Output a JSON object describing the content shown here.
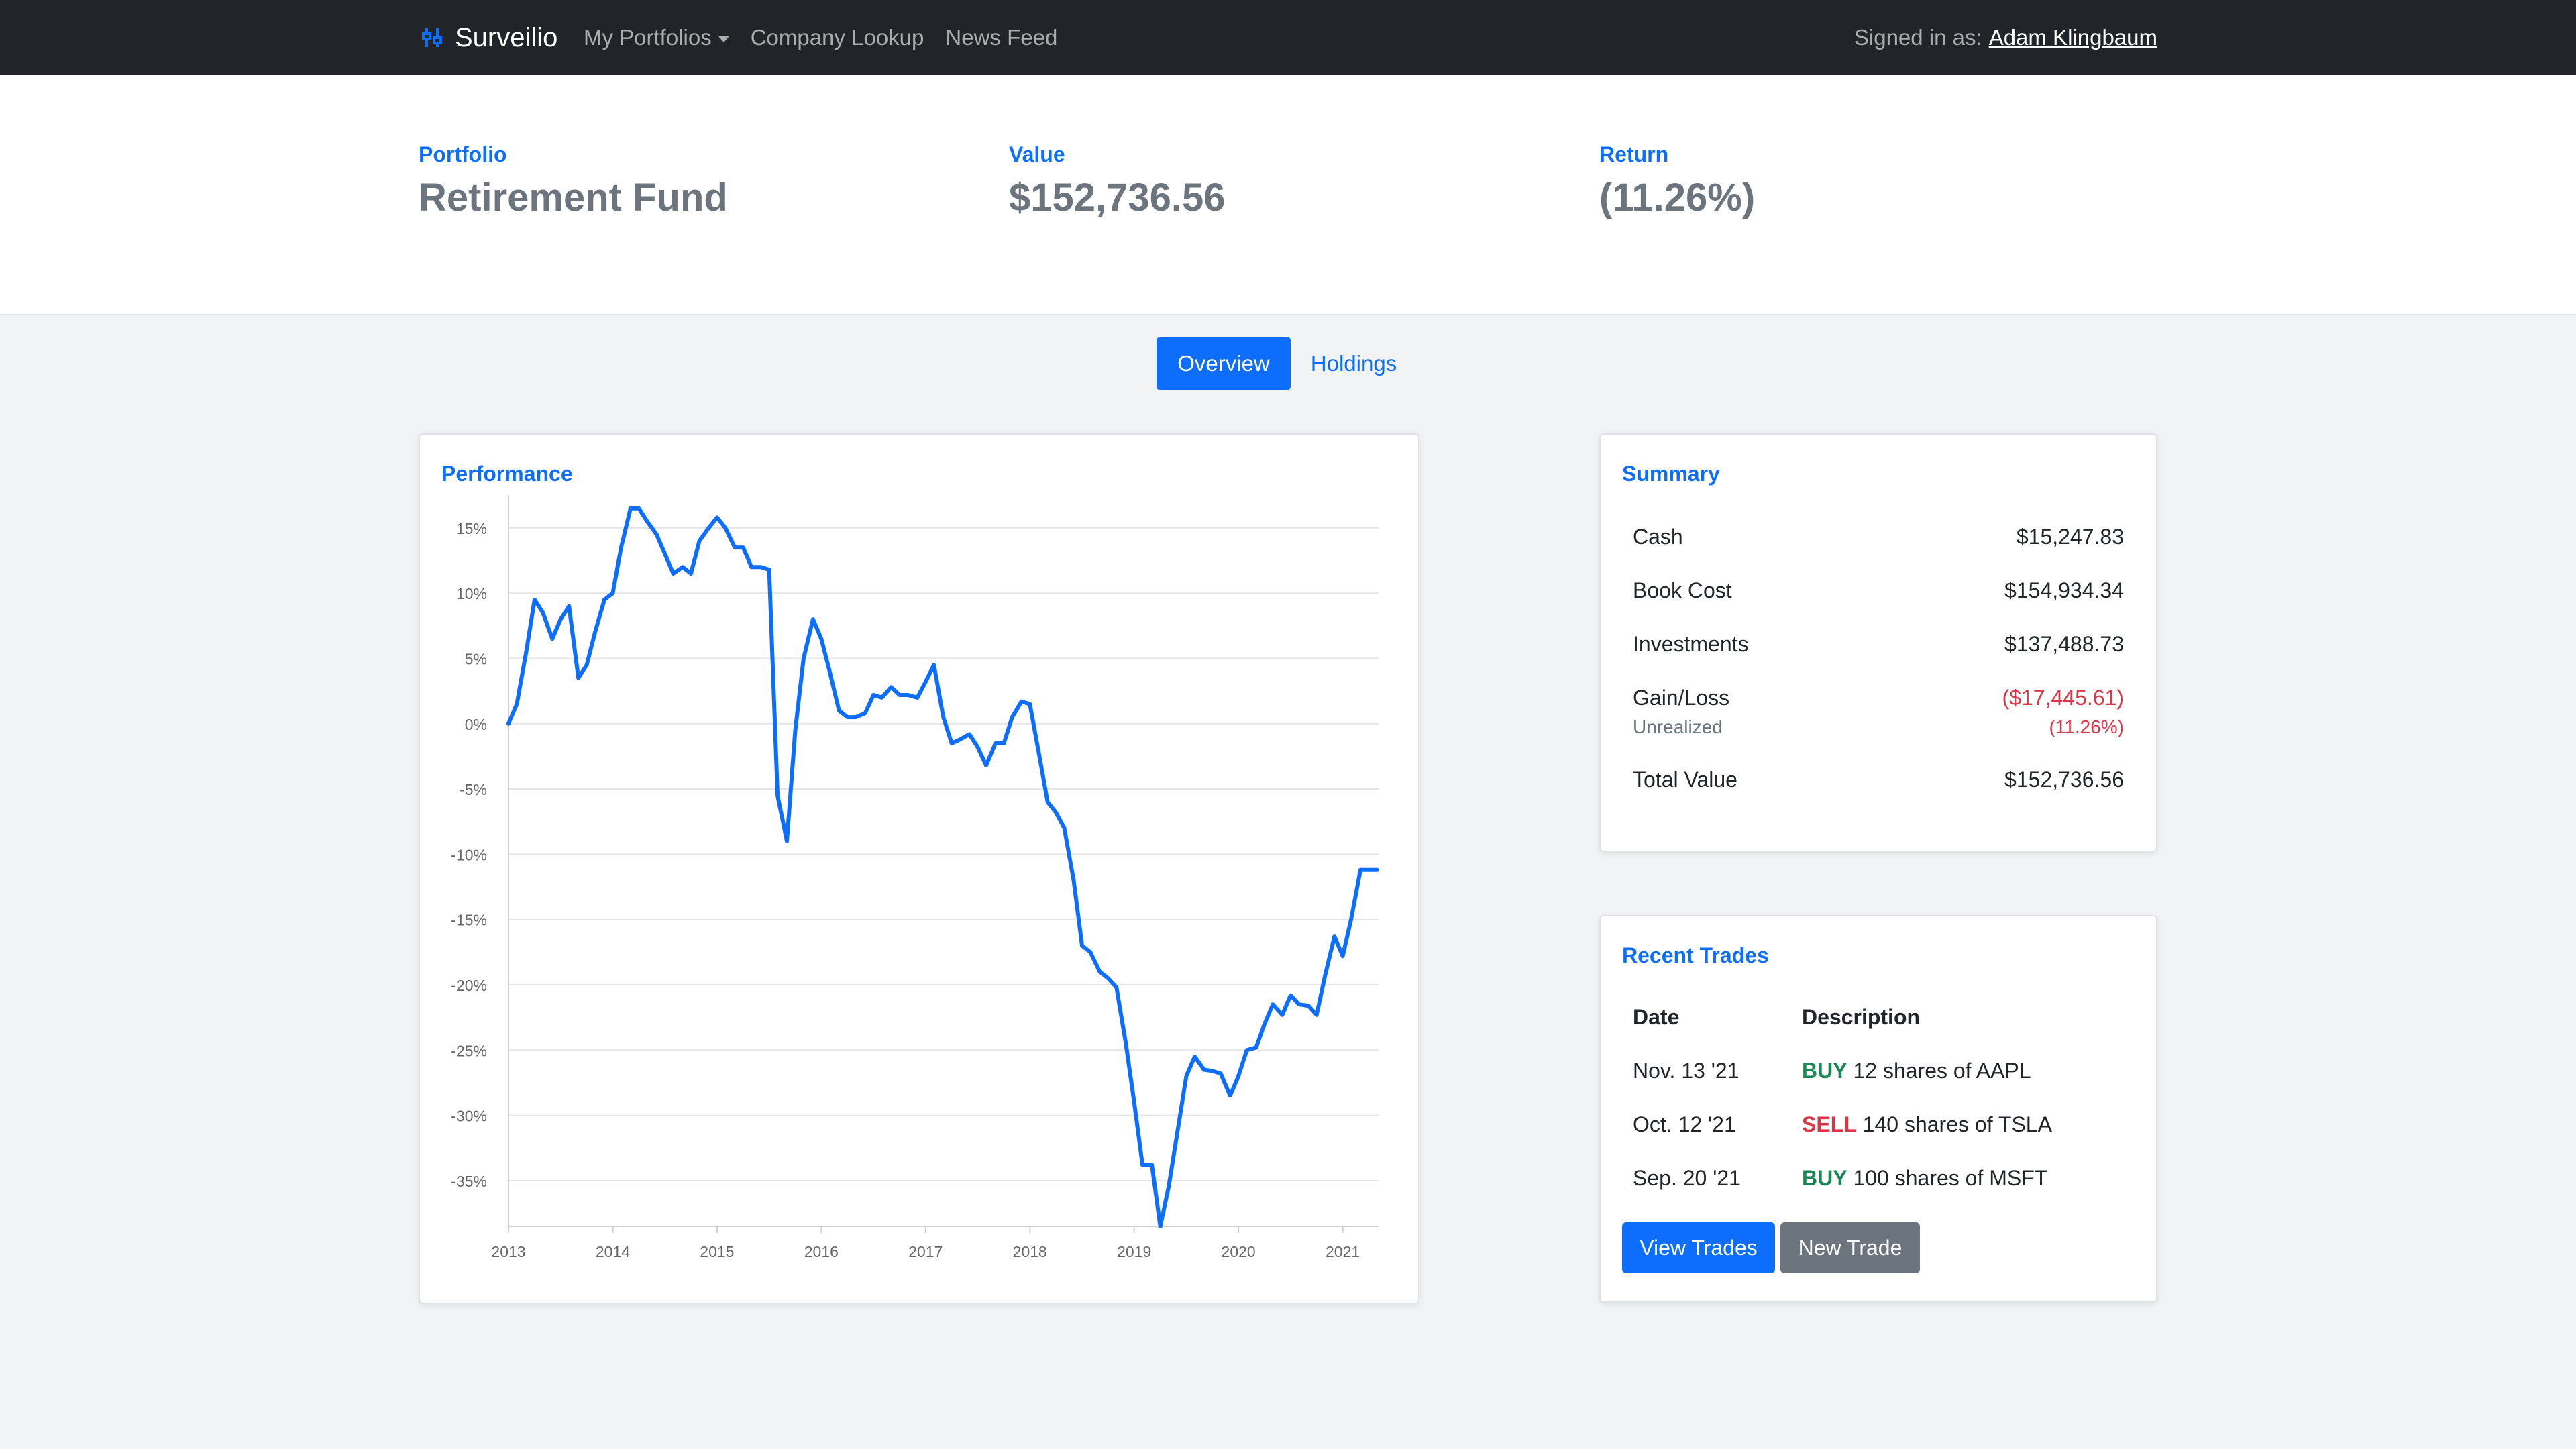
{
  "nav": {
    "brand": "Surveilio",
    "links": [
      "My Portfolios",
      "Company Lookup",
      "News Feed"
    ],
    "signed_in_label": "Signed in as:",
    "user": "Adam Klingbaum"
  },
  "hero": {
    "portfolio_label": "Portfolio",
    "portfolio_name": "Retirement Fund",
    "value_label": "Value",
    "value": "$152,736.56",
    "return_label": "Return",
    "return": "(11.26%)"
  },
  "tabs": [
    "Overview",
    "Holdings"
  ],
  "performance": {
    "title": "Performance"
  },
  "summary": {
    "title": "Summary",
    "rows": [
      {
        "label": "Cash",
        "value": "$15,247.83"
      },
      {
        "label": "Book Cost",
        "value": "$154,934.34"
      },
      {
        "label": "Investments",
        "value": "$137,488.73"
      },
      {
        "label": "Gain/Loss",
        "value": "($17,445.61)",
        "sublabel": "Unrealized",
        "subvalue": "(11.26%)"
      },
      {
        "label": "Total Value",
        "value": "$152,736.56"
      }
    ]
  },
  "trades": {
    "title": "Recent Trades",
    "headers": [
      "Date",
      "Description"
    ],
    "rows": [
      {
        "date": "Nov. 13 '21",
        "action": "BUY",
        "detail": "12 shares of AAPL"
      },
      {
        "date": "Oct. 12 '21",
        "action": "SELL",
        "detail": "140 shares of TSLA"
      },
      {
        "date": "Sep. 20 '21",
        "action": "BUY",
        "detail": "100 shares of MSFT"
      }
    ],
    "view_button": "View Trades",
    "new_button": "New Trade"
  },
  "colors": {
    "accent": "#0d6efd",
    "negative": "#dc3545",
    "positive": "#198754",
    "navbar": "#212529"
  },
  "chart_data": {
    "type": "line",
    "title": "",
    "xlabel": "",
    "ylabel": "",
    "ylim": [
      -38.5,
      17
    ],
    "yticks": [
      "15%",
      "10%",
      "5%",
      "0%",
      "-5%",
      "-10%",
      "-15%",
      "-20%",
      "-25%",
      "-30%",
      "-35%"
    ],
    "ytick_values": [
      15,
      10,
      5,
      0,
      -5,
      -10,
      -15,
      -20,
      -25,
      -30,
      -35
    ],
    "xticks": [
      "2013",
      "2014",
      "2015",
      "2016",
      "2017",
      "2018",
      "2019",
      "2020",
      "2021"
    ],
    "xlim": [
      2013,
      2021.35
    ],
    "series": [
      {
        "name": "",
        "color": "#0d6efd",
        "x": [
          2013.0,
          2013.08,
          2013.17,
          2013.25,
          2013.33,
          2013.42,
          2013.5,
          2013.58,
          2013.67,
          2013.75,
          2013.83,
          2013.92,
          2014.0,
          2014.08,
          2014.17,
          2014.25,
          2014.33,
          2014.42,
          2014.5,
          2014.58,
          2014.67,
          2014.75,
          2014.83,
          2014.92,
          2015.0,
          2015.08,
          2015.17,
          2015.25,
          2015.33,
          2015.42,
          2015.5,
          2015.58,
          2015.67,
          2015.75,
          2015.83,
          2015.92,
          2016.0,
          2016.08,
          2016.17,
          2016.25,
          2016.33,
          2016.42,
          2016.5,
          2016.58,
          2016.67,
          2016.75,
          2016.83,
          2016.92,
          2017.0,
          2017.08,
          2017.17,
          2017.25,
          2017.33,
          2017.42,
          2017.5,
          2017.58,
          2017.67,
          2017.75,
          2017.83,
          2017.92,
          2018.0,
          2018.08,
          2018.17,
          2018.25,
          2018.33,
          2018.42,
          2018.5,
          2018.58,
          2018.67,
          2018.75,
          2018.83,
          2018.92,
          2019.0,
          2019.08,
          2019.17,
          2019.25,
          2019.33,
          2019.42,
          2019.5,
          2019.58,
          2019.67,
          2019.75,
          2019.83,
          2019.92,
          2020.0,
          2020.08,
          2020.17,
          2020.25,
          2020.33,
          2020.42,
          2020.5,
          2020.58,
          2020.67,
          2020.75,
          2020.83,
          2020.92,
          2021.0,
          2021.08,
          2021.17,
          2021.25,
          2021.33
        ],
        "y": [
          0,
          1.5,
          5.5,
          9.5,
          8.5,
          6.5,
          8,
          9,
          3.5,
          4.5,
          7,
          9.5,
          10,
          13.5,
          16.5,
          16.5,
          15.5,
          14.5,
          13,
          11.5,
          12,
          11.5,
          14,
          15,
          15.8,
          15,
          13.5,
          13.5,
          12,
          12,
          11.8,
          -5.5,
          -9,
          -0.5,
          5,
          8,
          6.5,
          4,
          1,
          0.5,
          0.5,
          0.8,
          2.2,
          2,
          2.8,
          2.2,
          2.2,
          2,
          3.2,
          4.5,
          0.5,
          -1.5,
          -1.2,
          -0.8,
          -1.8,
          -3.2,
          -1.5,
          -1.5,
          0.5,
          1.7,
          1.5,
          -2,
          -6,
          -6.8,
          -8,
          -12,
          -17,
          -17.5,
          -19,
          -19.5,
          -20.2,
          -24.5,
          -29,
          -33.8,
          -33.8,
          -38.5,
          -35.5,
          -31,
          -27,
          -25.5,
          -26.5,
          -26.6,
          -26.8,
          -28.5,
          -27,
          -25,
          -24.8,
          -23,
          -21.5,
          -22.3,
          -20.8,
          -21.5,
          -21.6,
          -22.3,
          -19.3,
          -16.3,
          -17.8,
          -15,
          -11.2,
          -11.2,
          -11.2
        ]
      }
    ],
    "grid": true
  }
}
